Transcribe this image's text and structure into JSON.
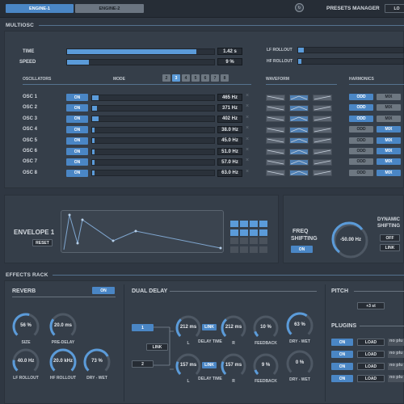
{
  "top": {
    "tabs": [
      "ENGINE-1",
      "ENGINE-2"
    ],
    "presets_label": "PRESETS MANAGER",
    "presets_btn": "LO"
  },
  "multiosc": {
    "title": "MULTIOSC",
    "time_label": "TIME",
    "time_value": "1.42 s",
    "time_fill": 0.88,
    "speed_label": "SPEED",
    "speed_value": "9 %",
    "speed_fill": 0.15,
    "lf_rollout": "LF ROLLOUT",
    "hf_rollout": "HF ROLLOUT",
    "osc_header": "OSCILLATORS",
    "mode_label": "MODE",
    "modes": [
      "2",
      "3",
      "4",
      "5",
      "6",
      "7",
      "8"
    ],
    "mode_selected": 1,
    "waveform_header": "WAVEFORM",
    "harmonics_header": "HARMONICS",
    "oscs": [
      {
        "name": "OSC 1",
        "state": "ON",
        "freq": "465 Hz",
        "odd": "ODD",
        "mix": "MIX",
        "harm": "odd"
      },
      {
        "name": "OSC 2",
        "state": "ON",
        "freq": "371 Hz",
        "odd": "ODD",
        "mix": "MIX",
        "harm": "odd"
      },
      {
        "name": "OSC 3",
        "state": "ON",
        "freq": "402 Hz",
        "odd": "ODD",
        "mix": "MIX",
        "harm": "odd"
      },
      {
        "name": "OSC 4",
        "state": "ON",
        "freq": "38.0 Hz",
        "odd": "ODD",
        "mix": "MIX",
        "harm": "mix"
      },
      {
        "name": "OSC 5",
        "state": "ON",
        "freq": "45.0 Hz",
        "odd": "ODD",
        "mix": "MIX",
        "harm": "mix"
      },
      {
        "name": "OSC 6",
        "state": "ON",
        "freq": "51.0 Hz",
        "odd": "ODD",
        "mix": "MIX",
        "harm": "mix"
      },
      {
        "name": "OSC 7",
        "state": "ON",
        "freq": "57.0 Hz",
        "odd": "ODD",
        "mix": "MIX",
        "harm": "mix"
      },
      {
        "name": "OSC 8",
        "state": "ON",
        "freq": "63.0 Hz",
        "odd": "ODD",
        "mix": "MIX",
        "harm": "mix"
      }
    ]
  },
  "envelope": {
    "title": "ENVELOPE 1",
    "reset": "RESET"
  },
  "freq": {
    "title_1": "FREQ",
    "title_2": "SHIFTING",
    "state": "ON",
    "value": "-50.00 Hz",
    "dyn_1": "DYNAMIC",
    "dyn_2": "SHIFTING",
    "off": "OFF",
    "link": "LINK"
  },
  "effects": {
    "title": "EFFECTS RACK"
  },
  "reverb": {
    "title": "REVERB",
    "state": "ON",
    "knobs": [
      {
        "value": "56 %",
        "label": "SIZE",
        "level": 0.56
      },
      {
        "value": "20.0 ms",
        "label": "PRE-DELAY",
        "level": 0.3
      },
      {
        "value": "40.0 Hz",
        "label": "LF ROLLOUT",
        "level": 0.2
      },
      {
        "value": "20.0 kHz",
        "label": "HF ROLLOUT",
        "level": 1.0
      },
      {
        "value": "73 %",
        "label": "DRY - WET",
        "level": 0.73
      }
    ]
  },
  "delay": {
    "title": "DUAL DELAY",
    "ch1": "1",
    "ch2": "2",
    "link": "LINK",
    "row1": {
      "l": "212 ms",
      "link": "LINK",
      "r": "212 ms",
      "fb": "10 %",
      "dw": "63 %"
    },
    "row2": {
      "l": "157 ms",
      "link": "LINK",
      "r": "157 ms",
      "fb": "9 %",
      "dw": "0 %"
    },
    "lbl_l": "L",
    "lbl_dt": "DELAY TIME",
    "lbl_r": "R",
    "lbl_fb": "FEEDBACK",
    "lbl_dw": "DRY - WET"
  },
  "pitch": {
    "title": "PITCH",
    "value": "+3 st"
  },
  "plugins": {
    "title": "PLUGINS",
    "rows": [
      {
        "state": "ON",
        "load": "LOAD",
        "name": "no plu"
      },
      {
        "state": "ON",
        "load": "LOAD",
        "name": "no plu"
      },
      {
        "state": "ON",
        "load": "LOAD",
        "name": "no plu"
      },
      {
        "state": "ON",
        "load": "LOAD",
        "name": "no plu"
      }
    ]
  }
}
